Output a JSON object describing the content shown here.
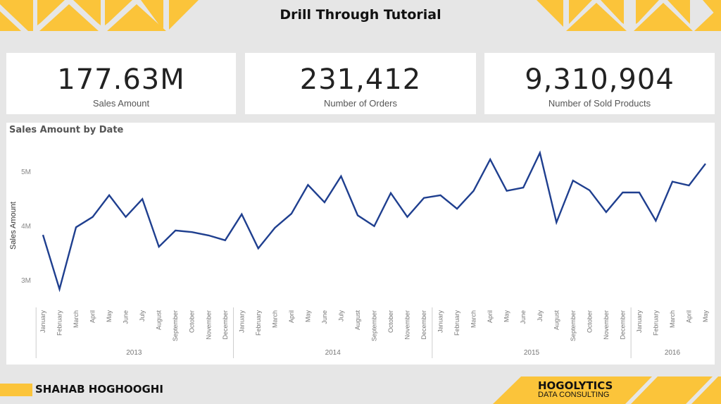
{
  "header": {
    "title": "Drill Through Tutorial"
  },
  "theme": {
    "accent": "#fbc43a",
    "line_color": "#1f3f8f",
    "background": "#e6e6e6"
  },
  "kpis": [
    {
      "value": "177.63M",
      "label": "Sales Amount"
    },
    {
      "value": "231,412",
      "label": "Number of Orders"
    },
    {
      "value": "9,310,904",
      "label": "Number of Sold Products"
    }
  ],
  "footer": {
    "author": "SHAHAB HOGHOOGHI",
    "logo_line1": "HOGOLYTICS",
    "logo_line2": "DATA CONSULTING"
  },
  "chart_data": {
    "type": "line",
    "title": "Sales Amount by Date",
    "xlabel": "",
    "ylabel": "Sales Amount",
    "ylim": [
      2.6,
      5.5
    ],
    "yticks": [
      {
        "value": 3,
        "label": "3M"
      },
      {
        "value": 4,
        "label": "4M"
      },
      {
        "value": 5,
        "label": "5M"
      }
    ],
    "grid": false,
    "units": "millions",
    "years": [
      {
        "label": "2013",
        "count": 12
      },
      {
        "label": "2014",
        "count": 12
      },
      {
        "label": "2015",
        "count": 12
      },
      {
        "label": "2016",
        "count": 5
      }
    ],
    "categories": [
      "January",
      "February",
      "March",
      "April",
      "May",
      "June",
      "July",
      "August",
      "September",
      "October",
      "November",
      "December",
      "January",
      "February",
      "March",
      "April",
      "May",
      "June",
      "July",
      "August",
      "September",
      "October",
      "November",
      "December",
      "January",
      "February",
      "March",
      "April",
      "May",
      "June",
      "July",
      "August",
      "September",
      "October",
      "November",
      "December",
      "January",
      "February",
      "March",
      "April",
      "May"
    ],
    "series": [
      {
        "name": "Sales Amount",
        "values": [
          3.83,
          2.83,
          3.97,
          4.16,
          4.56,
          4.16,
          4.49,
          3.61,
          3.91,
          3.88,
          3.82,
          3.73,
          4.21,
          3.58,
          3.96,
          4.22,
          4.75,
          4.43,
          4.91,
          4.19,
          3.99,
          4.6,
          4.16,
          4.51,
          4.56,
          4.31,
          4.64,
          5.22,
          4.64,
          4.7,
          5.34,
          4.06,
          4.83,
          4.65,
          4.25,
          4.61,
          4.61,
          4.09,
          4.81,
          4.74,
          5.14
        ]
      }
    ]
  }
}
